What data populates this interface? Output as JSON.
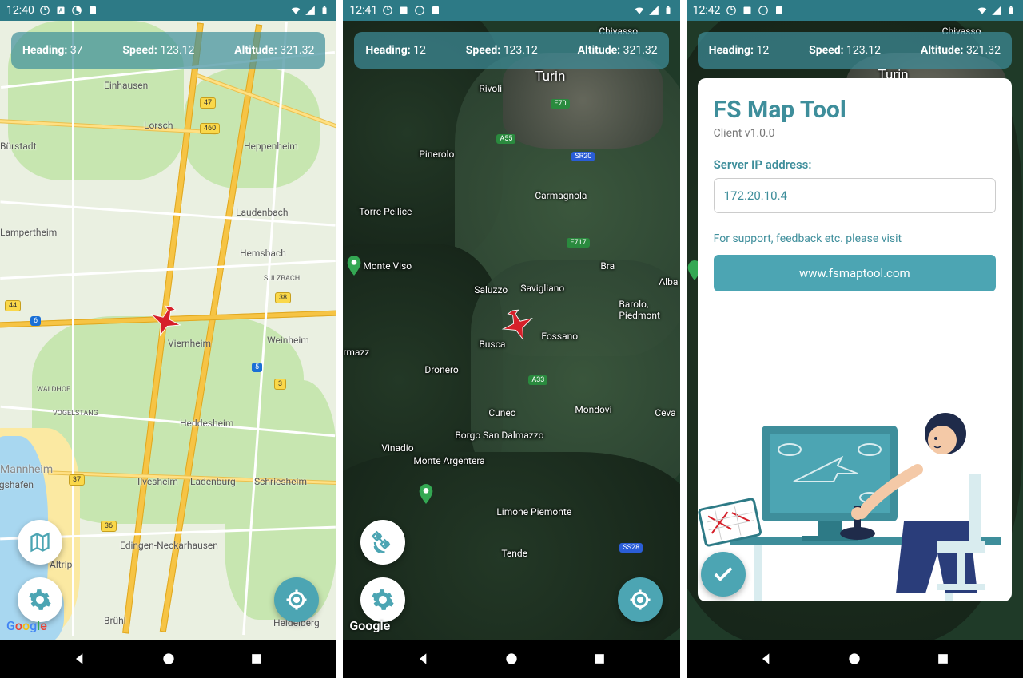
{
  "screens": [
    {
      "time": "12:40",
      "telemetry": {
        "heading_label": "Heading:",
        "heading": "37",
        "speed_label": "Speed:",
        "speed": "123.12",
        "alt_label": "Altitude:",
        "alt": "321.32"
      },
      "map_type": "road",
      "cities": [
        "Einhausen",
        "Lorsch",
        "Heppenheim",
        "Bürstadt",
        "Lampertheim",
        "Laudenbach",
        "Hemsbach",
        "SULZBACH",
        "Viernheim",
        "Weinheim",
        "WALDHOF",
        "VOGELSTANG",
        "Heddesheim",
        "Mannheim",
        "igshafen",
        "Ilvesheim",
        "Ladenburg",
        "Schriesheim",
        "Altrip",
        "Brühl",
        "Edingen-Neckarhausen",
        "Heidelberg"
      ],
      "shields": [
        "47",
        "460",
        "44",
        "38",
        "6",
        "5",
        "3",
        "37",
        "36"
      ],
      "google": "Google",
      "fab_top": "map-type",
      "fab_mid": "settings",
      "fab_right": "locate"
    },
    {
      "time": "12:41",
      "telemetry": {
        "heading_label": "Heading:",
        "heading": "12",
        "speed_label": "Speed:",
        "speed": "123.12",
        "alt_label": "Altitude:",
        "alt": "321.32"
      },
      "map_type": "satellite",
      "cities": [
        "Chivasso",
        "Turin",
        "Rivoli",
        "Pinerolo",
        "Carmagnola",
        "Torre Pellice",
        "Monte Viso",
        "Bra",
        "Alba",
        "Saluzzo",
        "Savigliano",
        "Barolo, Piedmont",
        "Busca",
        "Fossano",
        "rmazz",
        "Dronero",
        "Cuneo",
        "Mondovì",
        "Ceva",
        "Vinadio",
        "Borgo San Dalmazzo",
        "Monte Argentera",
        "Limone Piemonte",
        "Tende"
      ],
      "shields": [
        "E70",
        "A55",
        "SR20",
        "E717",
        "A33",
        "SS28"
      ],
      "google": "Google",
      "fab_top": "satellite",
      "fab_mid": "settings",
      "fab_right": "locate"
    },
    {
      "time": "12:42",
      "telemetry": {
        "heading_label": "Heading:",
        "heading": "12",
        "speed_label": "Speed:",
        "speed": "123.12",
        "alt_label": "Altitude:",
        "alt": "321.32"
      },
      "settings": {
        "title": "FS Map Tool",
        "version": "Client v1.0.0",
        "ip_label": "Server IP address:",
        "ip_value": "172.20.10.4",
        "support_text": "For support, feedback etc. please visit",
        "link": "www.fsmaptool.com"
      },
      "bg_cities": [
        "Chivasso",
        "Turin"
      ],
      "fab": "confirm"
    }
  ],
  "nav": {
    "back": "◀",
    "home": "●",
    "recents": "■"
  }
}
